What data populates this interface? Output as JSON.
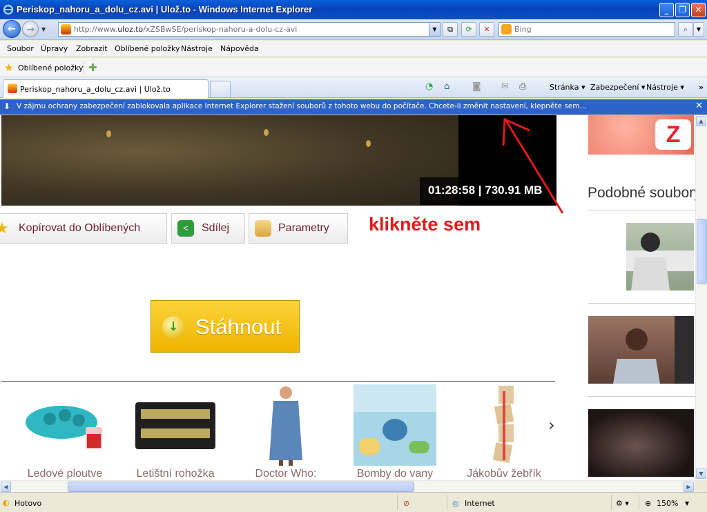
{
  "window": {
    "title": "Periskop_nahoru_a_dolu_cz.avi | Ulož.to - Windows Internet Explorer"
  },
  "address": {
    "url_prefix": "http://www.",
    "url_domain": "uloz.to",
    "url_path": "/xZSBwSE/periskop-nahoru-a-dolu-cz-avi"
  },
  "search": {
    "placeholder": "Bing"
  },
  "menu": {
    "items": [
      "Soubor",
      "Úpravy",
      "Zobrazit",
      "Oblíbené položky",
      "Nástroje",
      "Nápověda"
    ]
  },
  "favorites_bar": {
    "label": "Oblíbené položky"
  },
  "tab": {
    "title": "Periskop_nahoru_a_dolu_cz.avi | Ulož.to"
  },
  "command_bar": {
    "page": "Stránka",
    "security": "Zabezpečení",
    "tools": "Nástroje"
  },
  "infobar": {
    "message": "V zájmu ochrany zabezpečení zablokovala aplikace Internet Explorer stažení souborů z tohoto webu do počítače. Chcete-li změnit nastavení, klepněte sem..."
  },
  "video": {
    "info": "01:28:58 | 730.91 MB"
  },
  "actions": {
    "favorite": "Kopírovat do Oblíbených",
    "share": "Sdílej",
    "params": "Parametry"
  },
  "annotation": "klikněte sem",
  "download": {
    "label": "Stáhnout"
  },
  "products": [
    {
      "caption": "Ledové ploutve"
    },
    {
      "caption": "Letištní rohožka"
    },
    {
      "caption": "Doctor Who:"
    },
    {
      "caption": "Bomby do vany"
    },
    {
      "caption": "Jákobův žebřík"
    }
  ],
  "sidebar": {
    "heading": "Podobné soubory",
    "ad_letter": "Z"
  },
  "status": {
    "text": "Hotovo",
    "zone": "Internet",
    "zoom": "150%"
  },
  "colors": {
    "infobar": "#2d63c8",
    "annotation": "#e01b1b",
    "download": "#f0b400"
  }
}
